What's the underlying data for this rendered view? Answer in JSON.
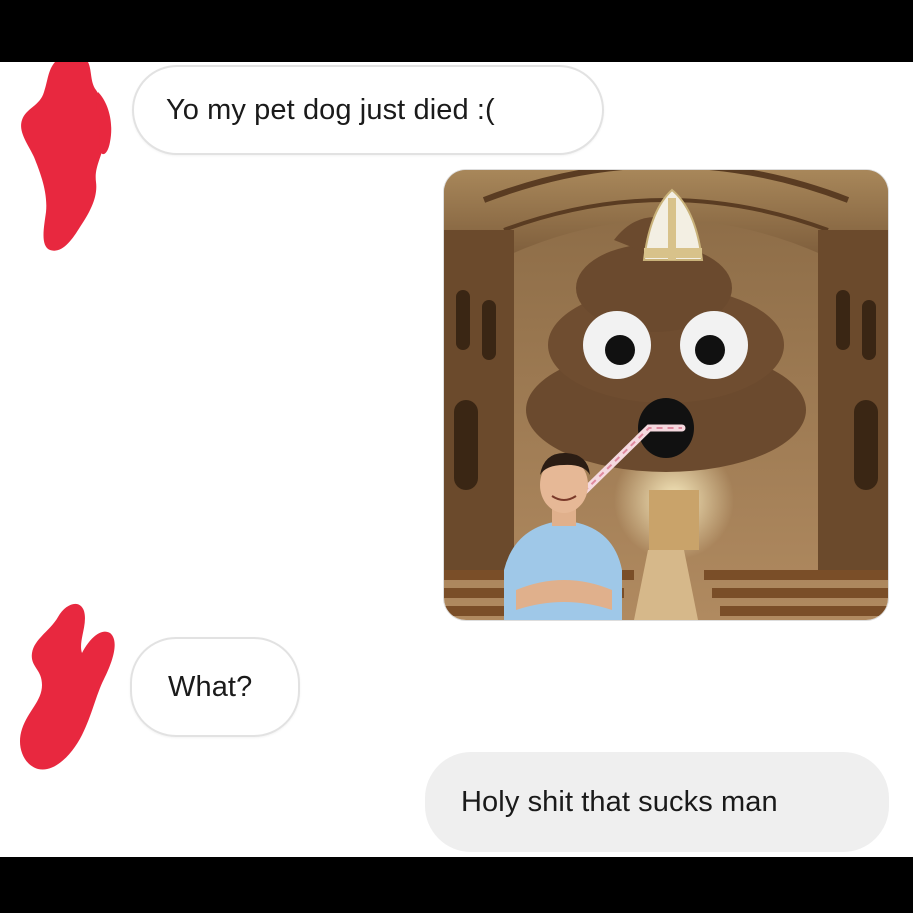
{
  "conversation": {
    "messages": [
      {
        "sender": "them",
        "text": "Yo my pet dog just died :("
      },
      {
        "sender": "me",
        "type": "image",
        "image_description_icon": "poop-emoji-pope-church-image"
      },
      {
        "sender": "them",
        "text": "What?"
      },
      {
        "sender": "me",
        "text": "Holy shit that sucks man"
      }
    ]
  },
  "colors": {
    "redaction": "#e8283f",
    "incoming_bubble_border": "#e2e2e2",
    "outgoing_bubble": "#efefef",
    "background": "#ffffff"
  }
}
